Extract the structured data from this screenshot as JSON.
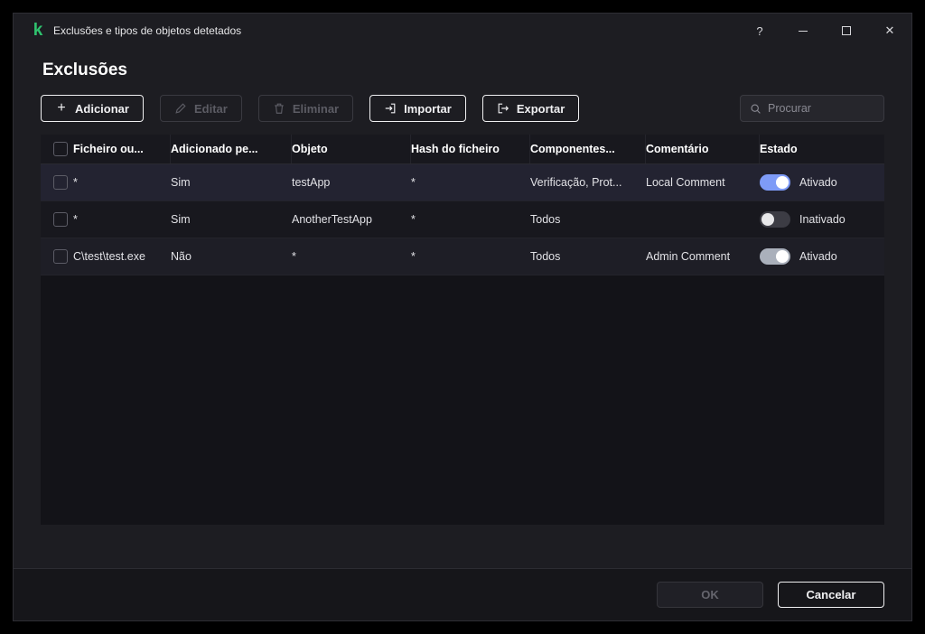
{
  "window": {
    "title": "Exclusões e tipos de objetos detetados",
    "help_glyph": "?",
    "close_glyph": "✕"
  },
  "page": {
    "title": "Exclusões"
  },
  "toolbar": {
    "add": "Adicionar",
    "edit": "Editar",
    "delete": "Eliminar",
    "import": "Importar",
    "export": "Exportar",
    "search_placeholder": "Procurar"
  },
  "table": {
    "headers": {
      "file": "Ficheiro ou...",
      "added_by": "Adicionado pe...",
      "object": "Objeto",
      "hash": "Hash do ficheiro",
      "components": "Componentes...",
      "comment": "Comentário",
      "state": "Estado"
    },
    "rows": [
      {
        "file": "*",
        "added_by": "Sim",
        "object": "testApp",
        "hash": "*",
        "components": "Verificação, Prot...",
        "comment": "Local Comment",
        "state_label": "Ativado",
        "toggle": "on"
      },
      {
        "file": "*",
        "added_by": "Sim",
        "object": "AnotherTestApp",
        "hash": "*",
        "components": "Todos",
        "comment": "",
        "state_label": "Inativado",
        "toggle": "off"
      },
      {
        "file": "C\\test\\test.exe",
        "added_by": "Não",
        "object": "*",
        "hash": "*",
        "components": "Todos",
        "comment": "Admin Comment",
        "state_label": "Ativado",
        "toggle": "on-muted"
      }
    ]
  },
  "footer": {
    "ok": "OK",
    "cancel": "Cancelar"
  },
  "colors": {
    "brand_green": "#2fc26e",
    "toggle_on": "#7e9bf7",
    "toggle_muted": "#aab0bb"
  }
}
